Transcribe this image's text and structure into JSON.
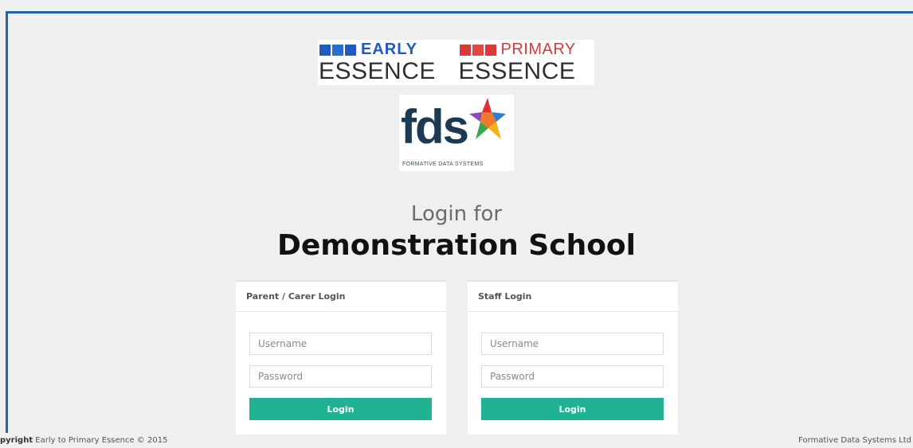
{
  "logos": {
    "early_word": "EARLY",
    "early_essence": "ESSENCE",
    "primary_word": "PRIMARY",
    "primary_essence": "ESSENCE",
    "fds_text": "fds",
    "fds_subtitle": "FORMATIVE DATA SYSTEMS",
    "early_icon_color": "#1f5bbf",
    "primary_icon_color": "#d83a3a"
  },
  "heading": {
    "login_for": "Login for",
    "school_name": "Demonstration School"
  },
  "parent_panel": {
    "title": "Parent / Carer Login",
    "username_placeholder": "Username",
    "password_placeholder": "Password",
    "login_label": "Login"
  },
  "staff_panel": {
    "title": "Staff Login",
    "username_placeholder": "Username",
    "password_placeholder": "Password",
    "login_label": "Login"
  },
  "footer": {
    "copyright_bold": "pyright",
    "copyright_text": " Early to Primary Essence © 2015",
    "company": "Formative Data Systems Ltd"
  },
  "colors": {
    "frame_border": "#2266aa",
    "button": "#1fb394",
    "background": "#efefef"
  }
}
